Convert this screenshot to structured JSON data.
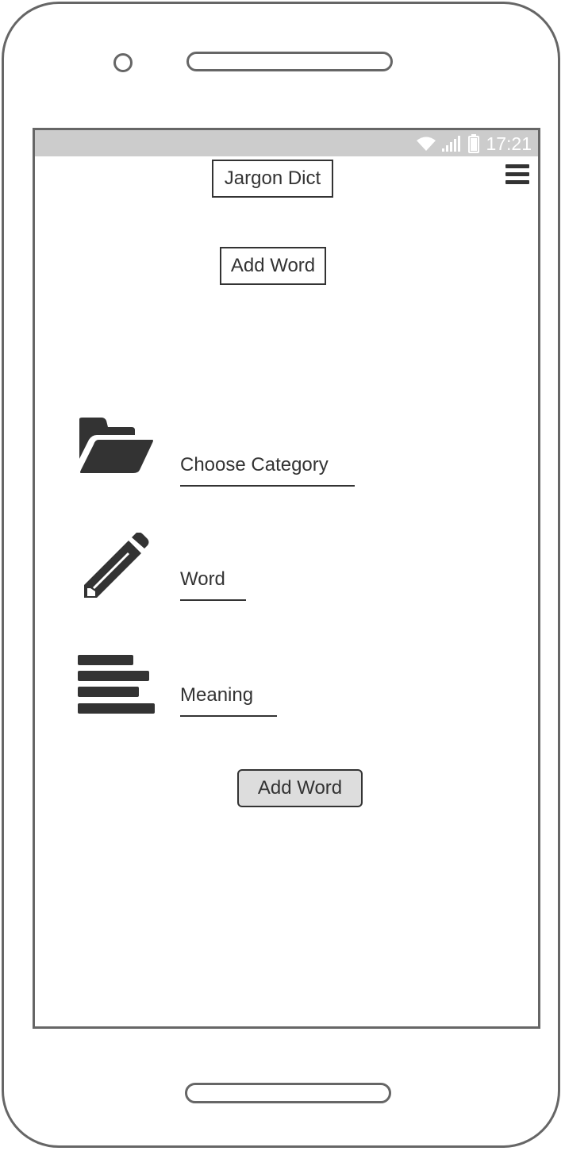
{
  "status_bar": {
    "time": "17:21",
    "icons": [
      "wifi-icon",
      "signal-icon",
      "battery-icon"
    ]
  },
  "app_bar": {
    "title": "Jargon Dict",
    "menu_icon": "hamburger-menu-icon"
  },
  "page": {
    "heading": "Add Word"
  },
  "form": {
    "category": {
      "placeholder": "Choose Category",
      "icon": "folder-open-icon"
    },
    "word": {
      "placeholder": "Word",
      "icon": "pencil-icon"
    },
    "meaning": {
      "placeholder": "Meaning",
      "icon": "text-lines-icon"
    },
    "submit_label": "Add Word"
  },
  "colors": {
    "frame": "#666666",
    "ink": "#333333",
    "status_bar": "#cccccc",
    "button_fill": "#dddddd"
  }
}
